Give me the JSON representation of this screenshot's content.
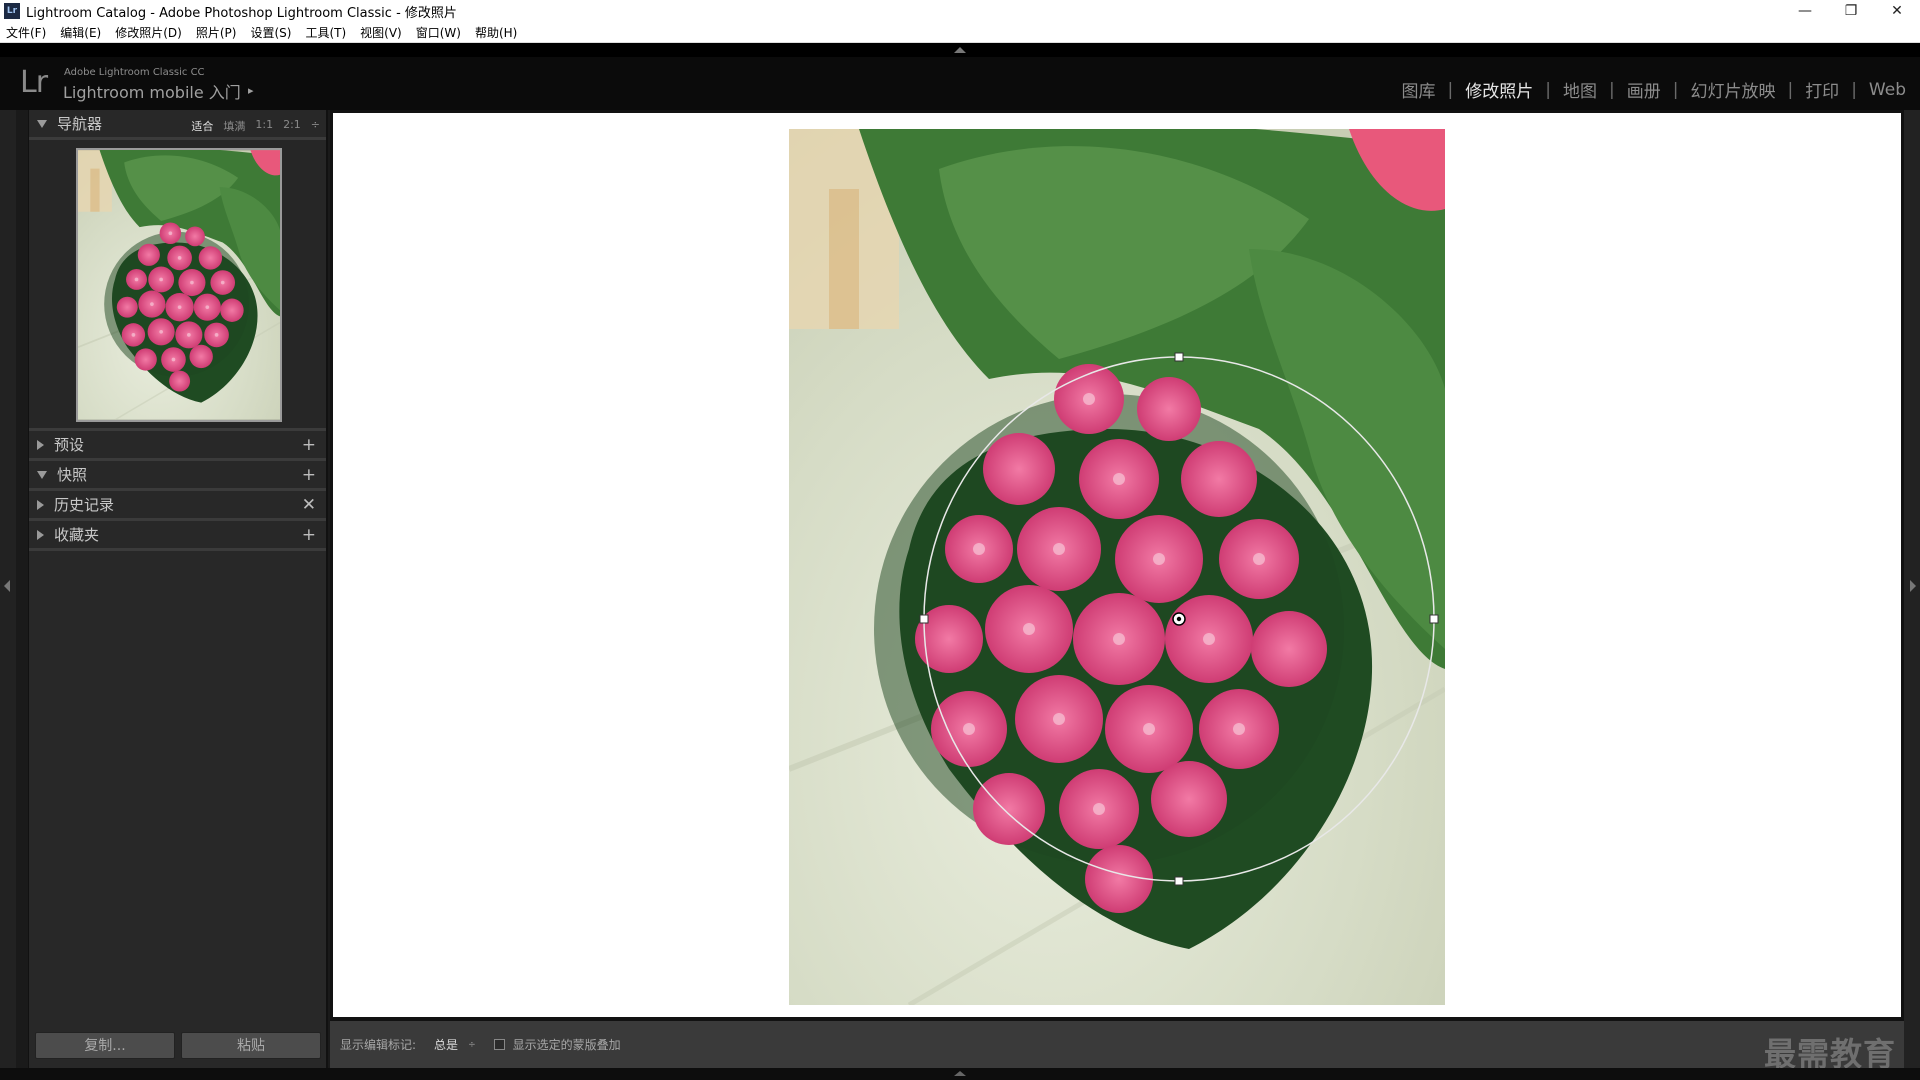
{
  "window": {
    "title": "Lightroom Catalog - Adobe Photoshop Lightroom Classic - 修改照片",
    "icon_text": "Lr",
    "controls": {
      "minimize": "—",
      "restore": "❐",
      "close": "✕"
    }
  },
  "menu": [
    "文件(F)",
    "编辑(E)",
    "修改照片(D)",
    "照片(P)",
    "设置(S)",
    "工具(T)",
    "视图(V)",
    "窗口(W)",
    "帮助(H)"
  ],
  "identity_plate": {
    "logo": "Lr",
    "small": "Adobe Lightroom Classic CC",
    "big": "Lightroom mobile 入门",
    "arrow": "▸"
  },
  "modules": [
    {
      "label": "图库",
      "active": false
    },
    {
      "label": "修改照片",
      "active": true
    },
    {
      "label": "地图",
      "active": false
    },
    {
      "label": "画册",
      "active": false
    },
    {
      "label": "幻灯片放映",
      "active": false
    },
    {
      "label": "打印",
      "active": false
    },
    {
      "label": "Web",
      "active": false
    }
  ],
  "module_separator": "|",
  "left_panel": {
    "navigator": {
      "title": "导航器",
      "zoom": [
        "适合",
        "填满",
        "1:1",
        "2:1"
      ],
      "zoom_active": "适合",
      "zoom_caret": "÷"
    },
    "panels": [
      {
        "title": "预设",
        "expanded": false,
        "action": "+"
      },
      {
        "title": "快照",
        "expanded": true,
        "action": "+"
      },
      {
        "title": "历史记录",
        "expanded": false,
        "action": "✕"
      },
      {
        "title": "收藏夹",
        "expanded": false,
        "action": "+"
      }
    ],
    "copy_button": "复制...",
    "paste_button": "粘贴"
  },
  "toolbar": {
    "label": "显示编辑标记:",
    "value": "总是",
    "caret": "÷",
    "overlay_checkbox_checked": false,
    "overlay_label": "显示选定的蒙版叠加"
  },
  "watermark": "最需教育",
  "colors": {
    "panel_bg": "#282828",
    "canvas_bg": "#ffffff",
    "accent_text": "#e6e6e6",
    "flower_pink": "#e0477f",
    "leaf_green": "#3f7a3a"
  }
}
